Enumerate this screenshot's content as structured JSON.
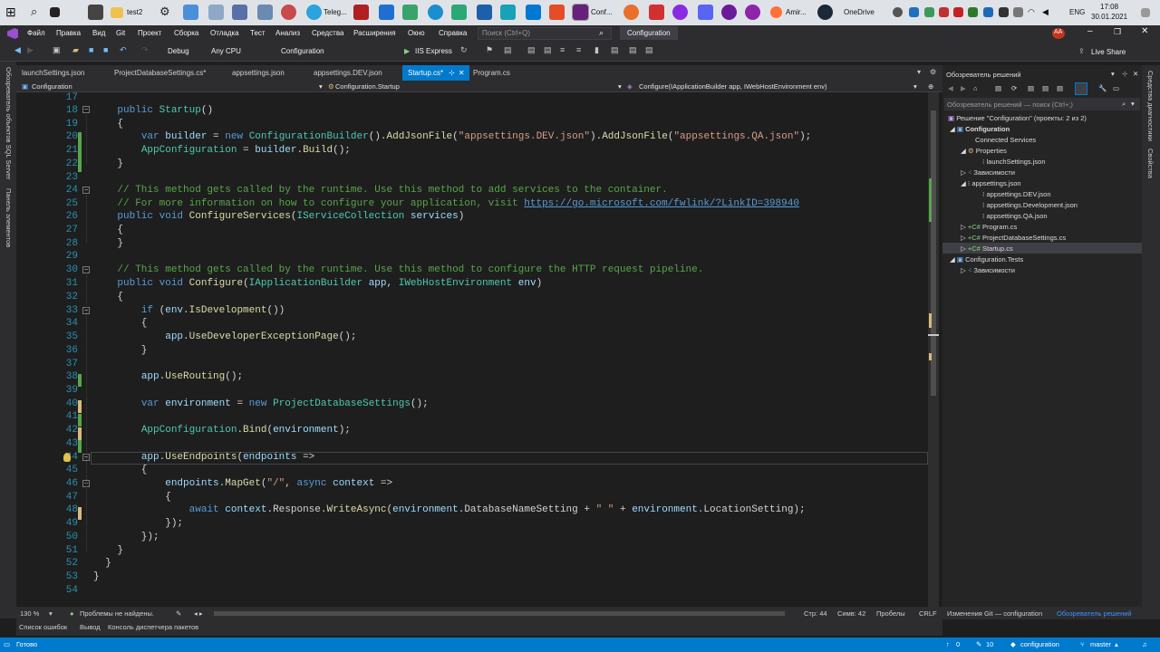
{
  "taskbar": {
    "items": [
      "test2",
      "Teleg...",
      "Conf...",
      "Amir...",
      "OneDrive"
    ],
    "time": "17:08",
    "date": "30.01.2021",
    "lang": "ENG"
  },
  "menu": {
    "items": [
      "Файл",
      "Правка",
      "Вид",
      "Git",
      "Проект",
      "Сборка",
      "Отладка",
      "Тест",
      "Анализ",
      "Средства",
      "Расширения",
      "Окно",
      "Справка"
    ],
    "search_placeholder": "Поиск (Ctrl+Q)",
    "solution_name": "Configuration",
    "avatar": "AA",
    "live_share": "Live Share"
  },
  "toolbar": {
    "config": "Debug",
    "platform": "Any CPU",
    "project": "Configuration",
    "run": "IIS Express"
  },
  "left_tools": [
    "Обозреватель объектов SQL Server",
    "Панель элементов"
  ],
  "tabs": [
    {
      "label": "launchSettings.json"
    },
    {
      "label": "ProjectDatabaseSettings.cs*"
    },
    {
      "label": "appsettings.json"
    },
    {
      "label": "appsettings.DEV.json"
    },
    {
      "label": "Startup.cs*",
      "active": true
    },
    {
      "label": "Program.cs"
    }
  ],
  "nav": {
    "project": "Configuration",
    "class": "Configuration.Startup",
    "member": "Configure(IApplicationBuilder app, IWebHostEnvironment env)"
  },
  "editor": {
    "line_numbers": [
      "17",
      "18",
      "19",
      "20",
      "21",
      "22",
      "23",
      "24",
      "25",
      "26",
      "27",
      "28",
      "29",
      "30",
      "31",
      "32",
      "33",
      "34",
      "35",
      "36",
      "37",
      "38",
      "39",
      "40",
      "41",
      "42",
      "43",
      "44",
      "45",
      "46",
      "47",
      "48",
      "49",
      "50",
      "51",
      "52",
      "53",
      "54"
    ]
  },
  "status_editor": {
    "zoom": "130 %",
    "problems": "Проблемы не найдены.",
    "line": "Стр: 44",
    "col": "Симв: 42",
    "spaces": "Пробелы",
    "eol": "CRLF"
  },
  "bottom_tabs": [
    "Список ошибок",
    "Вывод",
    "Консоль диспетчера пакетов"
  ],
  "statusbar": {
    "ready": "Готово",
    "up": "0",
    "pencil": "10",
    "repo": "configuration",
    "branch": "master"
  },
  "solution_explorer": {
    "title": "Обозреватель решений",
    "search_placeholder": "Обозреватель решений — поиск (Ctrl+;)",
    "items": [
      "Решение \"Configuration\" (проекты: 2 из 2)",
      "Configuration",
      "Connected Services",
      "Properties",
      "launchSettings.json",
      "Зависимости",
      "appsettings.json",
      "appsettings.DEV.json",
      "appsettings.Development.json",
      "appsettings.QA.json",
      "Program.cs",
      "ProjectDatabaseSettings.cs",
      "Startup.cs",
      "Configuration.Tests",
      "Зависимости"
    ],
    "tabs": [
      "Изменения Git — configuration",
      "Обозреватель решений"
    ]
  },
  "right_strip": [
    "Средства диагностики",
    "Свойства"
  ]
}
